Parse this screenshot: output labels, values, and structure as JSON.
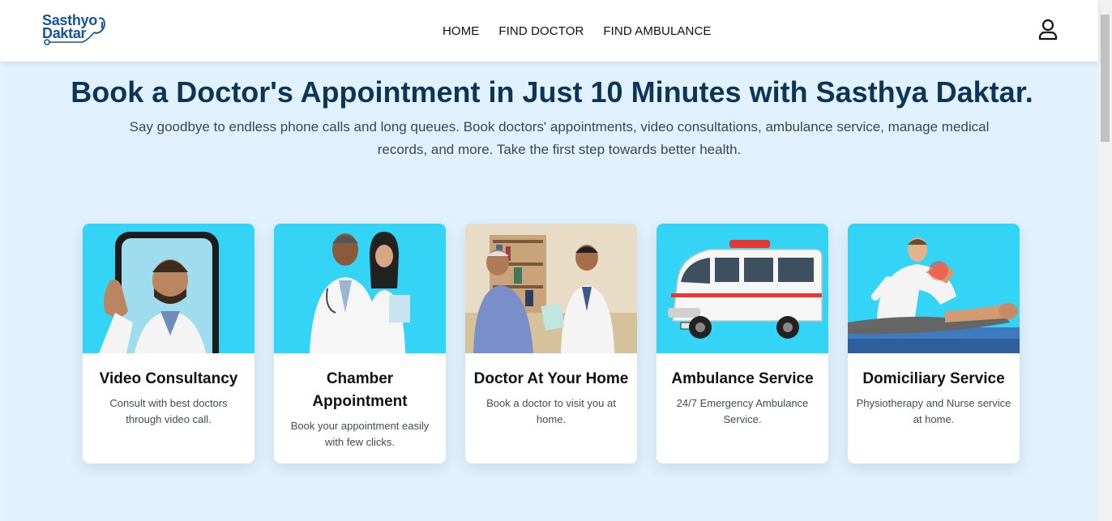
{
  "brand": {
    "line1": "Sasthyo",
    "line2": "Daktar"
  },
  "nav": {
    "home": "HOME",
    "find_doctor": "FIND DOCTOR",
    "find_ambulance": "FIND AMBULANCE"
  },
  "hero": {
    "title": "Book a Doctor's Appointment in Just 10 Minutes with Sasthya Daktar.",
    "subtitle": "Say goodbye to endless phone calls and long queues. Book doctors' appointments, video consultations, ambulance service, manage medical records, and more. Take the first step towards better health."
  },
  "cards": [
    {
      "title": "Video Consultancy",
      "description": "Consult with best doctors through video call.",
      "icon": "doctor-video-call-image"
    },
    {
      "title": "Chamber Appointment",
      "description": "Book your appointment easily with few clicks.",
      "icon": "doctors-chamber-image"
    },
    {
      "title": "Doctor At Your Home",
      "description": "Book a doctor to visit you at home.",
      "icon": "home-visit-image"
    },
    {
      "title": "Ambulance Service",
      "description": "24/7 Emergency Ambulance Service.",
      "icon": "ambulance-image"
    },
    {
      "title": "Domiciliary Service",
      "description": "Physiotherapy and Nurse service at home.",
      "icon": "physiotherapy-image"
    }
  ],
  "colors": {
    "brand_blue": "#1454a0",
    "hero_bg": "#e1f1fd",
    "title_navy": "#0d3558",
    "card_image_bg": "#33d4f5"
  }
}
